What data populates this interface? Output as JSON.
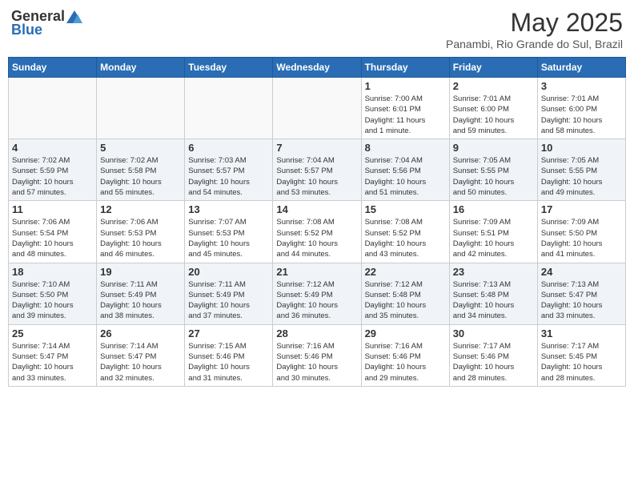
{
  "header": {
    "logo_general": "General",
    "logo_blue": "Blue",
    "title": "May 2025",
    "location": "Panambi, Rio Grande do Sul, Brazil"
  },
  "days_of_week": [
    "Sunday",
    "Monday",
    "Tuesday",
    "Wednesday",
    "Thursday",
    "Friday",
    "Saturday"
  ],
  "weeks": [
    [
      {
        "day": "",
        "info": ""
      },
      {
        "day": "",
        "info": ""
      },
      {
        "day": "",
        "info": ""
      },
      {
        "day": "",
        "info": ""
      },
      {
        "day": "1",
        "info": "Sunrise: 7:00 AM\nSunset: 6:01 PM\nDaylight: 11 hours\nand 1 minute."
      },
      {
        "day": "2",
        "info": "Sunrise: 7:01 AM\nSunset: 6:00 PM\nDaylight: 10 hours\nand 59 minutes."
      },
      {
        "day": "3",
        "info": "Sunrise: 7:01 AM\nSunset: 6:00 PM\nDaylight: 10 hours\nand 58 minutes."
      }
    ],
    [
      {
        "day": "4",
        "info": "Sunrise: 7:02 AM\nSunset: 5:59 PM\nDaylight: 10 hours\nand 57 minutes."
      },
      {
        "day": "5",
        "info": "Sunrise: 7:02 AM\nSunset: 5:58 PM\nDaylight: 10 hours\nand 55 minutes."
      },
      {
        "day": "6",
        "info": "Sunrise: 7:03 AM\nSunset: 5:57 PM\nDaylight: 10 hours\nand 54 minutes."
      },
      {
        "day": "7",
        "info": "Sunrise: 7:04 AM\nSunset: 5:57 PM\nDaylight: 10 hours\nand 53 minutes."
      },
      {
        "day": "8",
        "info": "Sunrise: 7:04 AM\nSunset: 5:56 PM\nDaylight: 10 hours\nand 51 minutes."
      },
      {
        "day": "9",
        "info": "Sunrise: 7:05 AM\nSunset: 5:55 PM\nDaylight: 10 hours\nand 50 minutes."
      },
      {
        "day": "10",
        "info": "Sunrise: 7:05 AM\nSunset: 5:55 PM\nDaylight: 10 hours\nand 49 minutes."
      }
    ],
    [
      {
        "day": "11",
        "info": "Sunrise: 7:06 AM\nSunset: 5:54 PM\nDaylight: 10 hours\nand 48 minutes."
      },
      {
        "day": "12",
        "info": "Sunrise: 7:06 AM\nSunset: 5:53 PM\nDaylight: 10 hours\nand 46 minutes."
      },
      {
        "day": "13",
        "info": "Sunrise: 7:07 AM\nSunset: 5:53 PM\nDaylight: 10 hours\nand 45 minutes."
      },
      {
        "day": "14",
        "info": "Sunrise: 7:08 AM\nSunset: 5:52 PM\nDaylight: 10 hours\nand 44 minutes."
      },
      {
        "day": "15",
        "info": "Sunrise: 7:08 AM\nSunset: 5:52 PM\nDaylight: 10 hours\nand 43 minutes."
      },
      {
        "day": "16",
        "info": "Sunrise: 7:09 AM\nSunset: 5:51 PM\nDaylight: 10 hours\nand 42 minutes."
      },
      {
        "day": "17",
        "info": "Sunrise: 7:09 AM\nSunset: 5:50 PM\nDaylight: 10 hours\nand 41 minutes."
      }
    ],
    [
      {
        "day": "18",
        "info": "Sunrise: 7:10 AM\nSunset: 5:50 PM\nDaylight: 10 hours\nand 39 minutes."
      },
      {
        "day": "19",
        "info": "Sunrise: 7:11 AM\nSunset: 5:49 PM\nDaylight: 10 hours\nand 38 minutes."
      },
      {
        "day": "20",
        "info": "Sunrise: 7:11 AM\nSunset: 5:49 PM\nDaylight: 10 hours\nand 37 minutes."
      },
      {
        "day": "21",
        "info": "Sunrise: 7:12 AM\nSunset: 5:49 PM\nDaylight: 10 hours\nand 36 minutes."
      },
      {
        "day": "22",
        "info": "Sunrise: 7:12 AM\nSunset: 5:48 PM\nDaylight: 10 hours\nand 35 minutes."
      },
      {
        "day": "23",
        "info": "Sunrise: 7:13 AM\nSunset: 5:48 PM\nDaylight: 10 hours\nand 34 minutes."
      },
      {
        "day": "24",
        "info": "Sunrise: 7:13 AM\nSunset: 5:47 PM\nDaylight: 10 hours\nand 33 minutes."
      }
    ],
    [
      {
        "day": "25",
        "info": "Sunrise: 7:14 AM\nSunset: 5:47 PM\nDaylight: 10 hours\nand 33 minutes."
      },
      {
        "day": "26",
        "info": "Sunrise: 7:14 AM\nSunset: 5:47 PM\nDaylight: 10 hours\nand 32 minutes."
      },
      {
        "day": "27",
        "info": "Sunrise: 7:15 AM\nSunset: 5:46 PM\nDaylight: 10 hours\nand 31 minutes."
      },
      {
        "day": "28",
        "info": "Sunrise: 7:16 AM\nSunset: 5:46 PM\nDaylight: 10 hours\nand 30 minutes."
      },
      {
        "day": "29",
        "info": "Sunrise: 7:16 AM\nSunset: 5:46 PM\nDaylight: 10 hours\nand 29 minutes."
      },
      {
        "day": "30",
        "info": "Sunrise: 7:17 AM\nSunset: 5:46 PM\nDaylight: 10 hours\nand 28 minutes."
      },
      {
        "day": "31",
        "info": "Sunrise: 7:17 AM\nSunset: 5:45 PM\nDaylight: 10 hours\nand 28 minutes."
      }
    ]
  ]
}
